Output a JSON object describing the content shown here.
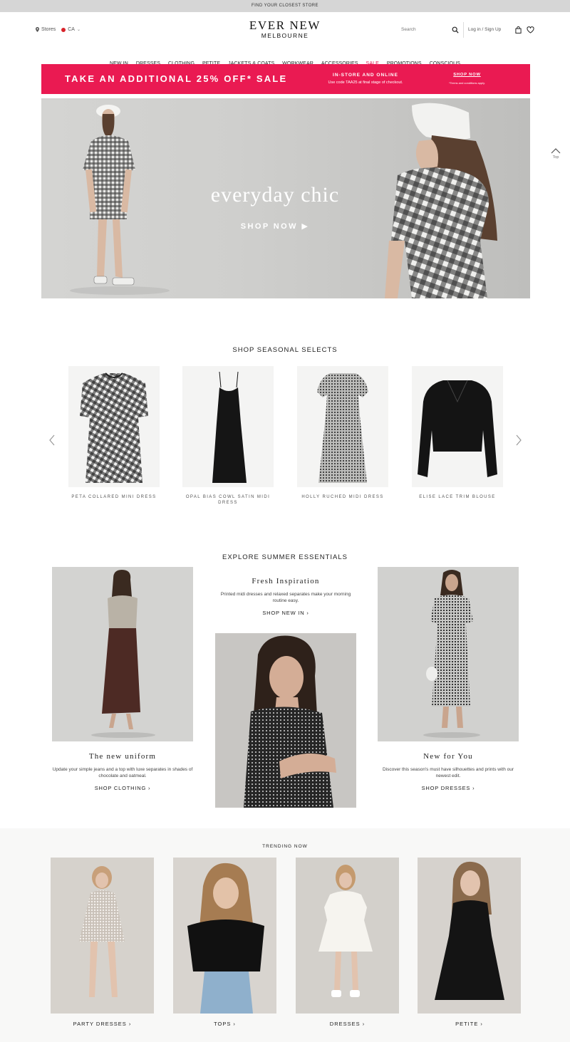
{
  "topbar": {
    "text": "FIND YOUR CLOSEST STORE"
  },
  "header": {
    "stores_label": "Stores",
    "country_label": "CA",
    "logo_line1": "EVER NEW",
    "logo_line2": "MELBOURNE",
    "search_placeholder": "Search",
    "login_label": "Log in / Sign Up"
  },
  "nav": {
    "items": [
      "NEW IN",
      "DRESSES",
      "CLOTHING",
      "PETITE",
      "JACKETS & COATS",
      "WORKWEAR",
      "ACCESSORIES",
      "SALE",
      "PROMOTIONS",
      "CONSCIOUS"
    ]
  },
  "promo": {
    "headline": "TAKE AN ADDITIONAL 25% OFF* SALE",
    "channel": "IN-STORE AND ONLINE",
    "code_text": "Use code TAA25 at final stage of checkout.",
    "cta": "SHOP NOW",
    "terms": "*Terms and conditions apply."
  },
  "hero": {
    "title": "everyday chic",
    "cta": "SHOP NOW ▶"
  },
  "back_to_top": "Top",
  "seasonal": {
    "title": "SHOP SEASONAL SELECTS",
    "products": [
      {
        "name": "PETA COLLARED MINI DRESS"
      },
      {
        "name": "OPAL BIAS COWL SATIN MIDI DRESS"
      },
      {
        "name": "HOLLY RUCHED MIDI DRESS"
      },
      {
        "name": "ELISE LACE TRIM BLOUSE"
      }
    ]
  },
  "essentials": {
    "title": "EXPLORE SUMMER ESSENTIALS",
    "left": {
      "heading": "The new uniform",
      "text": "Update your simple jeans and a top with luxe separates in shades of chocolate and oatmeal.",
      "link": "SHOP CLOTHING ›"
    },
    "center": {
      "heading": "Fresh Inspiration",
      "text": "Printed midi dresses and relaxed separates make your morning routine easy.",
      "link": "SHOP NEW IN ›"
    },
    "right": {
      "heading": "New for You",
      "text": "Discover this season's must have silhouettes and prints with our newest edit.",
      "link": "SHOP DRESSES ›"
    }
  },
  "trending": {
    "title": "TRENDING NOW",
    "items": [
      {
        "label": "PARTY DRESSES ›"
      },
      {
        "label": "TOPS ›"
      },
      {
        "label": "DRESSES ›"
      },
      {
        "label": "PETITE ›"
      }
    ]
  },
  "colors": {
    "accent": "#ea1a52",
    "sale": "#e0154f"
  }
}
